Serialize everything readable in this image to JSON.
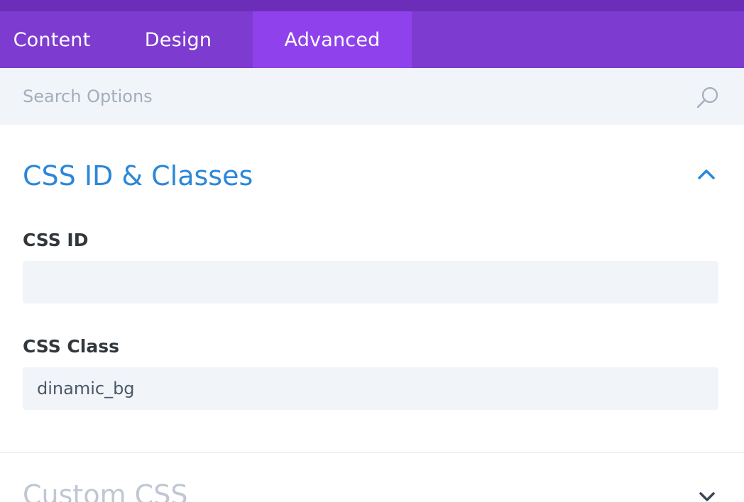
{
  "tabs": [
    {
      "label": "Content",
      "active": false
    },
    {
      "label": "Design",
      "active": false
    },
    {
      "label": "Advanced",
      "active": true
    }
  ],
  "search": {
    "placeholder": "Search Options",
    "value": ""
  },
  "sections": {
    "css_id_classes": {
      "title": "CSS ID & Classes",
      "expanded": true,
      "css_id_label": "CSS ID",
      "css_id_value": "",
      "css_class_label": "CSS Class",
      "css_class_value": "dinamic_bg"
    },
    "custom_css": {
      "title": "Custom CSS",
      "expanded": false
    }
  },
  "icons": {
    "search": "search-icon",
    "collapse": "chevron-up-icon",
    "expand": "chevron-down-icon"
  },
  "colors": {
    "header_strip": "#6c2eb9",
    "tab_bar": "#7e3bd0",
    "active_tab": "#8f42ec",
    "section_title": "#2b87da",
    "input_bg": "#f1f4f9"
  }
}
